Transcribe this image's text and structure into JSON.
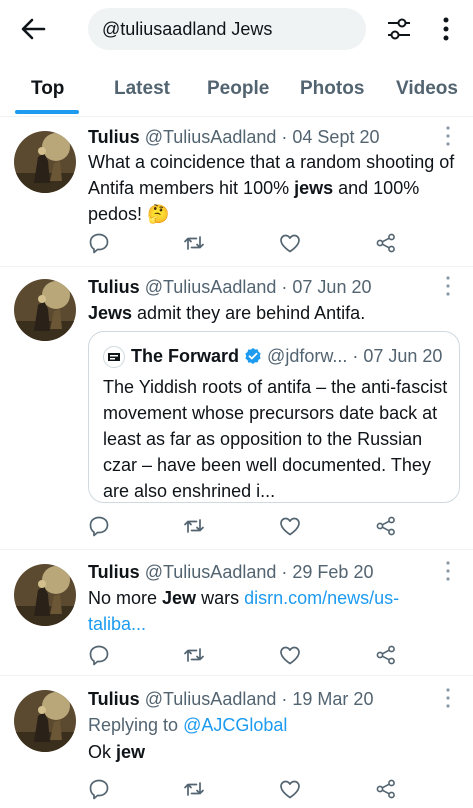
{
  "search": {
    "query": "@tuliusaadland Jews"
  },
  "tabs": [
    {
      "label": "Top"
    },
    {
      "label": "Latest"
    },
    {
      "label": "People"
    },
    {
      "label": "Photos"
    },
    {
      "label": "Videos"
    }
  ],
  "tweets": [
    {
      "name": "Tulius",
      "handle": "@TuliusAadland",
      "date": "04 Sept 20",
      "parts": [
        "What a coincidence that a random shooting of Antifa members hit 100% ",
        "jews",
        " and 100% pedos! ",
        "🤔"
      ]
    },
    {
      "name": "Tulius",
      "handle": "@TuliusAadland",
      "date": "07 Jun 20",
      "parts": [
        "Jews",
        " admit they are behind Antifa."
      ],
      "quote": {
        "name": "The Forward",
        "handle": "@jdforw...",
        "date": "07 Jun 20",
        "text": "The Yiddish roots of antifa – the anti-fascist movement whose precursors date back at least as far as opposition to the Russian czar – have been well documented. They are also enshrined i..."
      }
    },
    {
      "name": "Tulius",
      "handle": "@TuliusAadland",
      "date": "29 Feb 20",
      "parts": [
        "No more ",
        "Jew",
        " wars "
      ],
      "link": "disrn.com/news/us-taliba..."
    },
    {
      "name": "Tulius",
      "handle": "@TuliusAadland",
      "date": "19 Mar 20",
      "reply_prefix": "Replying to ",
      "reply_to": "@AJCGlobal",
      "parts": [
        "Ok ",
        "jew"
      ]
    }
  ],
  "colors": {
    "accent": "#1d9bf0",
    "secondary_text": "#536471",
    "verified": "#1d9bf0"
  }
}
